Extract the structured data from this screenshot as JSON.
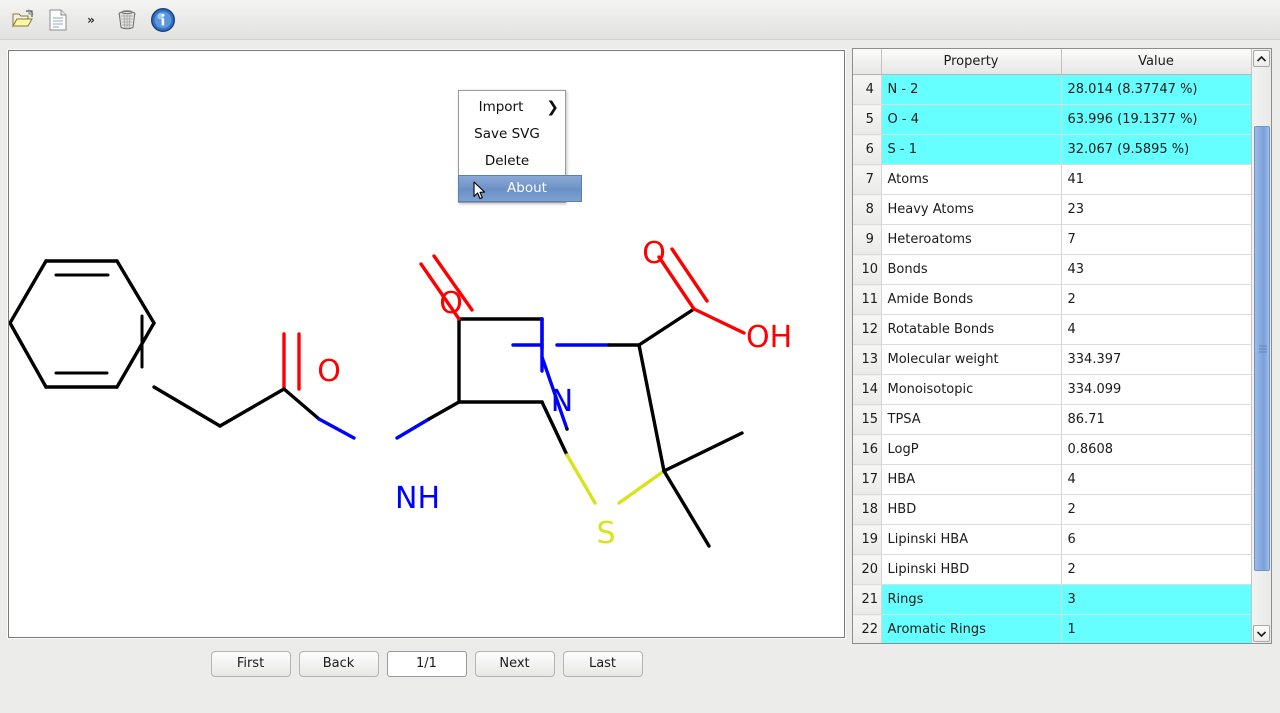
{
  "toolbar": {
    "buttons": [
      {
        "name": "open-folder-icon",
        "label": "Open"
      },
      {
        "name": "document-icon",
        "label": "New"
      },
      {
        "name": "overflow-chevron-icon",
        "label": "»"
      },
      {
        "name": "trash-icon",
        "label": "Delete"
      },
      {
        "name": "info-icon",
        "label": "Info"
      }
    ]
  },
  "context_menu": {
    "items": [
      {
        "label": "Import",
        "has_submenu": true,
        "submenu_arrow": "❯",
        "selected": false
      },
      {
        "label": "Save SVG",
        "has_submenu": false,
        "selected": false
      },
      {
        "label": "Delete",
        "has_submenu": false,
        "selected": false
      },
      {
        "label": "About",
        "has_submenu": false,
        "selected": true
      }
    ],
    "selected_bg": "#6f93c8"
  },
  "structure": {
    "name": "penicillin-g-structure",
    "atom_labels": [
      {
        "text": "O",
        "color": "#ff0000"
      },
      {
        "text": "NH",
        "color": "#0000ff"
      },
      {
        "text": "O",
        "color": "#ff0000"
      },
      {
        "text": "N",
        "color": "#0000ff"
      },
      {
        "text": "O",
        "color": "#ff0000"
      },
      {
        "text": "OH",
        "color": "#ff0000"
      },
      {
        "text": "S",
        "color": "#d8e31c"
      }
    ],
    "colors": {
      "carbon_bond": "#000000",
      "oxygen": "#ff0000",
      "nitrogen": "#0000ff",
      "sulfur": "#d8e31c"
    }
  },
  "navigation": {
    "first_label": "First",
    "back_label": "Back",
    "page_value": "1/1",
    "next_label": "Next",
    "last_label": "Last"
  },
  "table": {
    "headers": {
      "rownum": "",
      "property": "Property",
      "value": "Value"
    },
    "highlight_color": "#66FFFF",
    "rows": [
      {
        "num": "4",
        "property": "N - 2",
        "value": "28.014 (8.37747 %)",
        "highlight": true
      },
      {
        "num": "5",
        "property": "O - 4",
        "value": "63.996 (19.1377 %)",
        "highlight": true
      },
      {
        "num": "6",
        "property": "S - 1",
        "value": "32.067 (9.5895 %)",
        "highlight": true
      },
      {
        "num": "7",
        "property": "Atoms",
        "value": "41",
        "highlight": false
      },
      {
        "num": "8",
        "property": "Heavy Atoms",
        "value": "23",
        "highlight": false
      },
      {
        "num": "9",
        "property": "Heteroatoms",
        "value": "7",
        "highlight": false
      },
      {
        "num": "10",
        "property": "Bonds",
        "value": "43",
        "highlight": false
      },
      {
        "num": "11",
        "property": "Amide Bonds",
        "value": "2",
        "highlight": false
      },
      {
        "num": "12",
        "property": "Rotatable Bonds",
        "value": "4",
        "highlight": false
      },
      {
        "num": "13",
        "property": "Molecular weight",
        "value": "334.397",
        "highlight": false
      },
      {
        "num": "14",
        "property": "Monoisotopic",
        "value": "334.099",
        "highlight": false
      },
      {
        "num": "15",
        "property": "TPSA",
        "value": "86.71",
        "highlight": false
      },
      {
        "num": "16",
        "property": "LogP",
        "value": "0.8608",
        "highlight": false
      },
      {
        "num": "17",
        "property": "HBA",
        "value": "4",
        "highlight": false
      },
      {
        "num": "18",
        "property": "HBD",
        "value": "2",
        "highlight": false
      },
      {
        "num": "19",
        "property": "Lipinski HBA",
        "value": "6",
        "highlight": false
      },
      {
        "num": "20",
        "property": "Lipinski HBD",
        "value": "2",
        "highlight": false
      },
      {
        "num": "21",
        "property": "Rings",
        "value": "3",
        "highlight": true
      },
      {
        "num": "22",
        "property": "Aromatic Rings",
        "value": "1",
        "highlight": true
      }
    ]
  },
  "scrollbar": {
    "up_arrow": "▲",
    "down_arrow": "▼"
  }
}
